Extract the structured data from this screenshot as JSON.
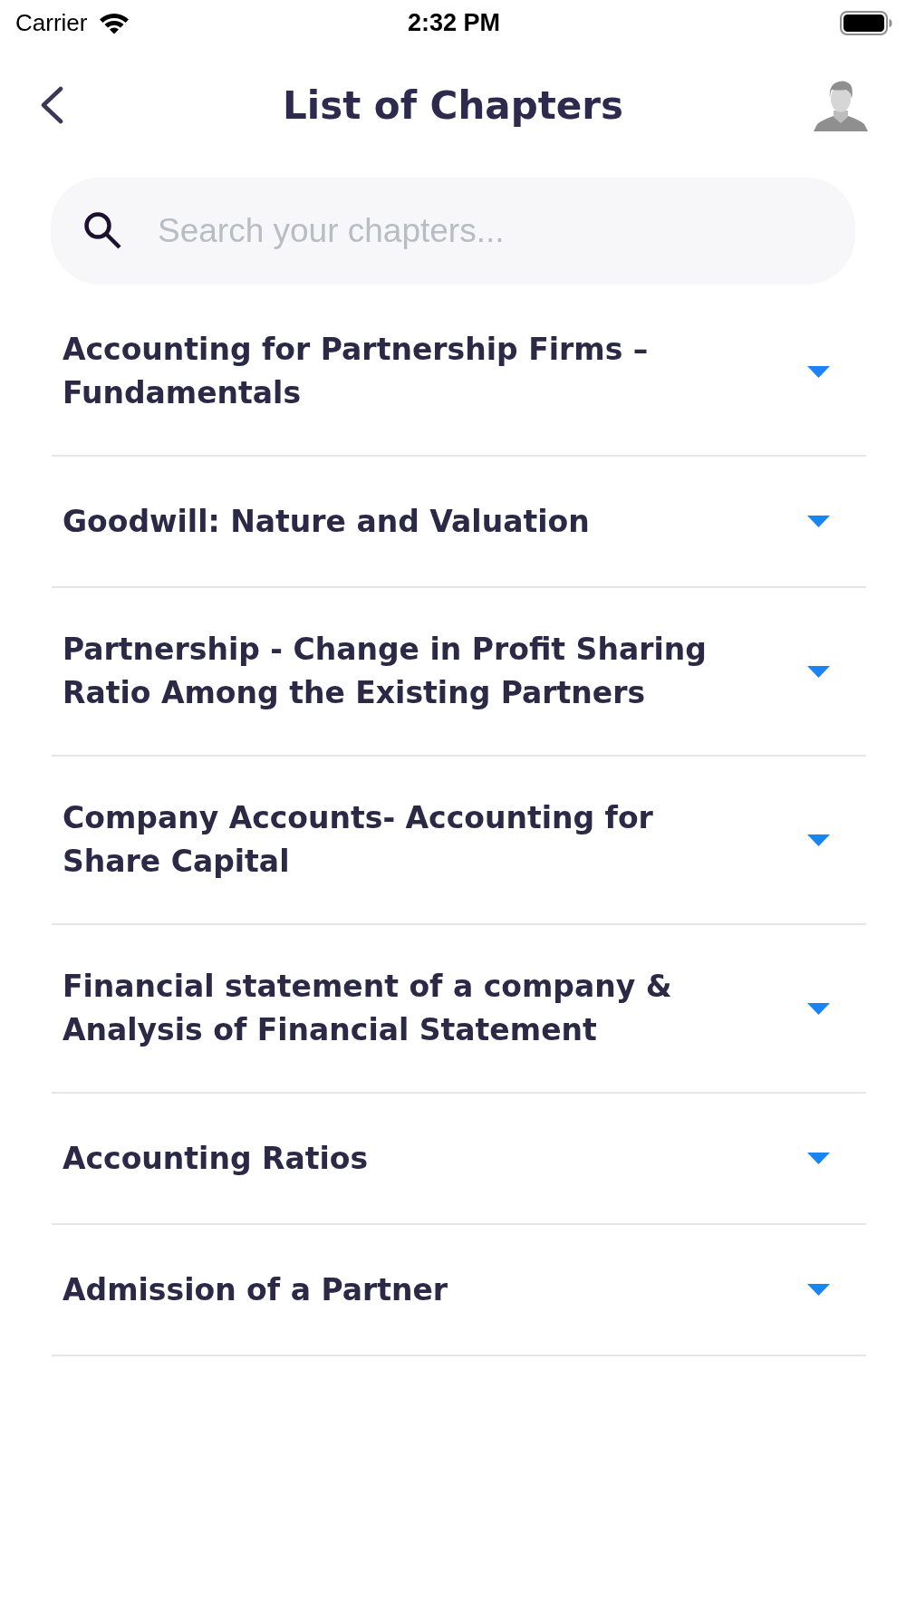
{
  "status_bar": {
    "carrier": "Carrier",
    "time": "2:32 PM"
  },
  "header": {
    "title": "List of Chapters"
  },
  "search": {
    "placeholder": "Search your chapters..."
  },
  "chapters": [
    {
      "title": "Accounting for Partnership Firms – Fundamentals",
      "expanded": false
    },
    {
      "title": "Goodwill: Nature and Valuation",
      "expanded": false
    },
    {
      "title": "Partnership - Change in Profit Sharing Ratio Among the Existing Partners",
      "expanded": false
    },
    {
      "title": "Company Accounts- Accounting for Share Capital",
      "expanded": false
    },
    {
      "title": "Financial statement of a company & Analysis of Financial Statement",
      "expanded": false
    },
    {
      "title": "Accounting Ratios",
      "expanded": false
    },
    {
      "title": "Admission of a Partner",
      "expanded": false
    }
  ]
}
